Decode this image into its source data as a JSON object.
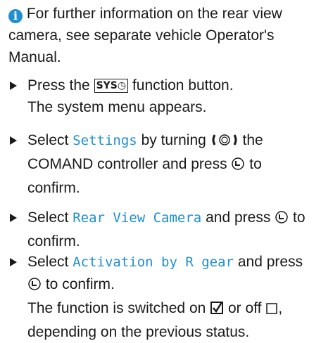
{
  "info": {
    "icon": "info-icon",
    "text": "For further information on the rear view camera, see separate vehicle Operator's Manual."
  },
  "steps": [
    {
      "pre": "Press the",
      "key": "SYS",
      "post": "function button.",
      "result": "The system menu appears."
    },
    {
      "pre": "Select",
      "menu": "Settings",
      "mid": "by turning",
      "post1": "the COMAND controller and press",
      "post2": "to confirm."
    },
    {
      "pre": "Select",
      "menu": "Rear View Camera",
      "post1": "and press",
      "post2": "to confirm."
    },
    {
      "pre": "Select",
      "menu": "Activation by R gear",
      "post1": "and press",
      "post2": "to confirm.",
      "result_a": "The function is switched on",
      "result_b": "or off",
      "result_c": ", depending on the previous status."
    }
  ],
  "colors": {
    "accent": "#1f8fd0",
    "text": "#1a1a1a"
  }
}
